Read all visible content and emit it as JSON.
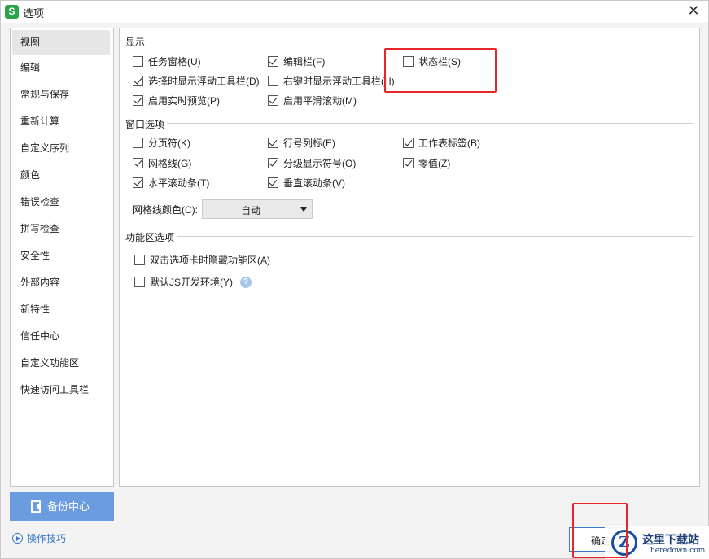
{
  "window": {
    "title": "选项",
    "app_icon": "S",
    "close_glyph": "✕"
  },
  "sidebar": {
    "items": [
      {
        "label": "视图",
        "active": true
      },
      {
        "label": "编辑"
      },
      {
        "label": "常规与保存"
      },
      {
        "label": "重新计算"
      },
      {
        "label": "自定义序列"
      },
      {
        "label": "颜色"
      },
      {
        "label": "错误检查"
      },
      {
        "label": "拼写检查"
      },
      {
        "label": "安全性"
      },
      {
        "label": "外部内容"
      },
      {
        "label": "新特性"
      },
      {
        "label": "信任中心"
      },
      {
        "label": "自定义功能区"
      },
      {
        "label": "快速访问工具栏"
      }
    ]
  },
  "backup": {
    "label": "备份中心",
    "icon": "backup-icon"
  },
  "tips": {
    "label": "操作技巧",
    "icon": "play-circle-icon"
  },
  "display": {
    "title": "显示",
    "options": [
      {
        "label": "任务窗格(U)",
        "checked": false
      },
      {
        "label": "编辑栏(F)",
        "checked": true
      },
      {
        "label": "状态栏(S)",
        "checked": false
      },
      {
        "label": "选择时显示浮动工具栏(D)",
        "checked": true
      },
      {
        "label": "右键时显示浮动工具栏(H)",
        "checked": false
      },
      {
        "label": "启用实时预览(P)",
        "checked": true
      },
      {
        "label": "启用平滑滚动(M)",
        "checked": true
      }
    ]
  },
  "window_options": {
    "title": "窗口选项",
    "options": [
      {
        "label": "分页符(K)",
        "checked": false
      },
      {
        "label": "行号列标(E)",
        "checked": true
      },
      {
        "label": "工作表标签(B)",
        "checked": true
      },
      {
        "label": "网格线(G)",
        "checked": true
      },
      {
        "label": "分级显示符号(O)",
        "checked": true
      },
      {
        "label": "零值(Z)",
        "checked": true
      },
      {
        "label": "水平滚动条(T)",
        "checked": true
      },
      {
        "label": "垂直滚动条(V)",
        "checked": true
      }
    ],
    "grid_color_label": "网格线颜色(C):",
    "grid_color_value": "自动"
  },
  "ribbon": {
    "title": "功能区选项",
    "options": [
      {
        "label": "双击选项卡时隐藏功能区(A)",
        "checked": false
      },
      {
        "label": "默认JS开发环境(Y)",
        "checked": false
      }
    ],
    "help_glyph": "?"
  },
  "ok_button": {
    "label": "确定"
  },
  "watermark": {
    "logo": "Z",
    "cn": "这里下载站",
    "en": "heredown.com"
  },
  "colors": {
    "accent": "#6b9ce0",
    "highlight": "#e6262b",
    "link": "#3a78c9"
  }
}
